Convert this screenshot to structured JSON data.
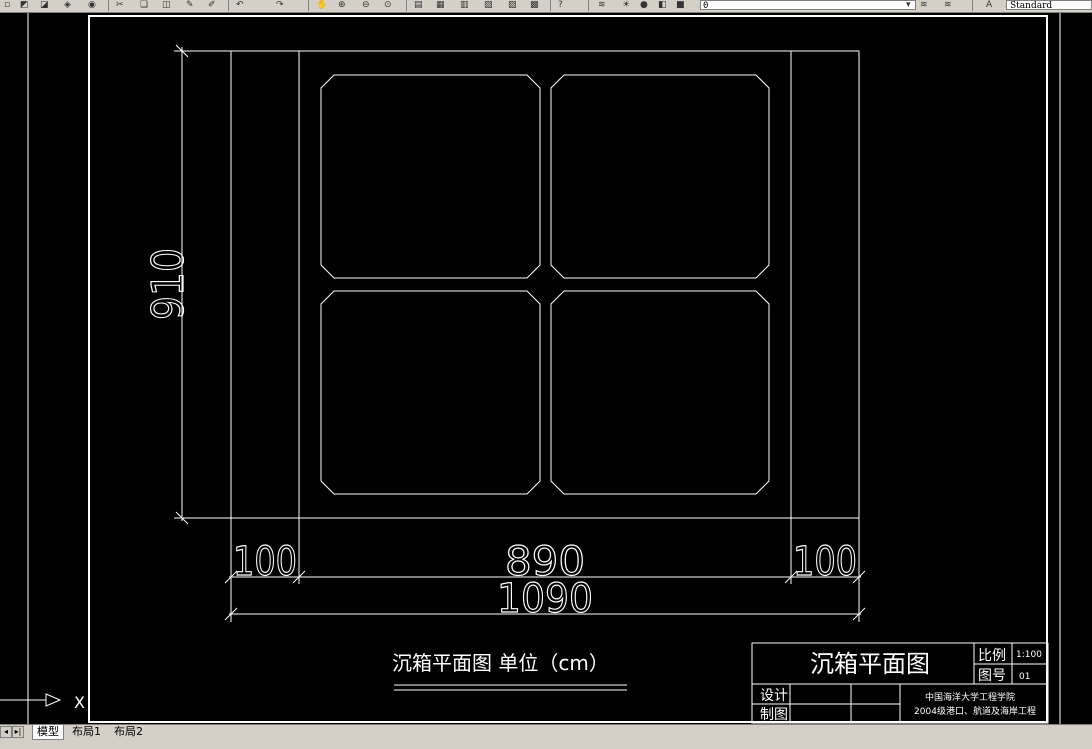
{
  "toolbar": {
    "layer_value": "0",
    "text_style_value": "Standard",
    "icons": [
      "new-icon",
      "open-icon",
      "save-icon",
      "print-icon",
      "preview-icon",
      "cut-icon",
      "copy-icon",
      "paste-icon",
      "matchprop-icon",
      "undo-icon",
      "redo-icon",
      "pan-icon",
      "zoom-realtime-icon",
      "zoom-window-icon",
      "zoom-previous-icon",
      "properties-icon",
      "designcenter-icon",
      "toolpalettes-icon",
      "sheetset-icon",
      "markup-icon",
      "calculator-icon",
      "help-icon",
      "layer-manager-icon",
      "layer-state-icons",
      "style-icon"
    ]
  },
  "drawing": {
    "dim_height": "910",
    "dim_left": "100",
    "dim_middle": "890",
    "dim_right": "100",
    "dim_total": "1090",
    "caption": "沉箱平面图 单位（cm）",
    "ucs_axis_label": "X"
  },
  "title_block": {
    "title": "沉箱平面图",
    "scale_label": "比例",
    "scale_value": "1:100",
    "drawing_no_label": "图号",
    "drawing_no_value": "01",
    "design_label": "设计",
    "draft_label": "制图",
    "institution": "中国海洋大学工程学院",
    "program": "2004级港口、航道及海岸工程"
  },
  "tabs": [
    {
      "label": "模型",
      "active": true
    },
    {
      "label": "布局1",
      "active": false
    },
    {
      "label": "布局2",
      "active": false
    }
  ],
  "colors": {
    "background": "#000000",
    "linework": "#ffffff",
    "ui_face": "#d4d0c8"
  }
}
